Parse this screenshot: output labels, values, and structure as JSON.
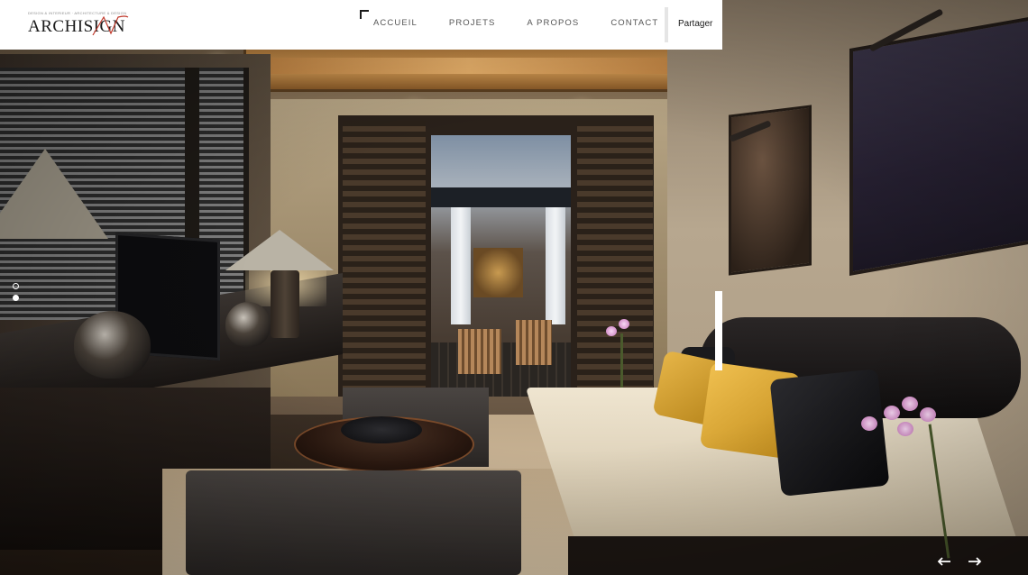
{
  "header": {
    "logo": {
      "tagline": "DESIGN & INTERIEUR · ARCHITECTURE & DESIGN",
      "word": "ARCHISIGN"
    },
    "nav": [
      {
        "label": "ACCUEIL"
      },
      {
        "label": "PROJETS"
      },
      {
        "label": "A PROPOS"
      },
      {
        "label": "CONTACT"
      }
    ],
    "share_label": "Partager"
  },
  "slider": {
    "slide_count": 2,
    "active_index": 1,
    "prev_icon": "arrow-left-icon",
    "next_icon": "arrow-right-icon"
  },
  "colors": {
    "header_bg": "#ffffff",
    "nav_text": "#555555",
    "logo_text": "#1b1b1b",
    "logo_accent": "#c0392b",
    "controls": "#ffffff"
  }
}
